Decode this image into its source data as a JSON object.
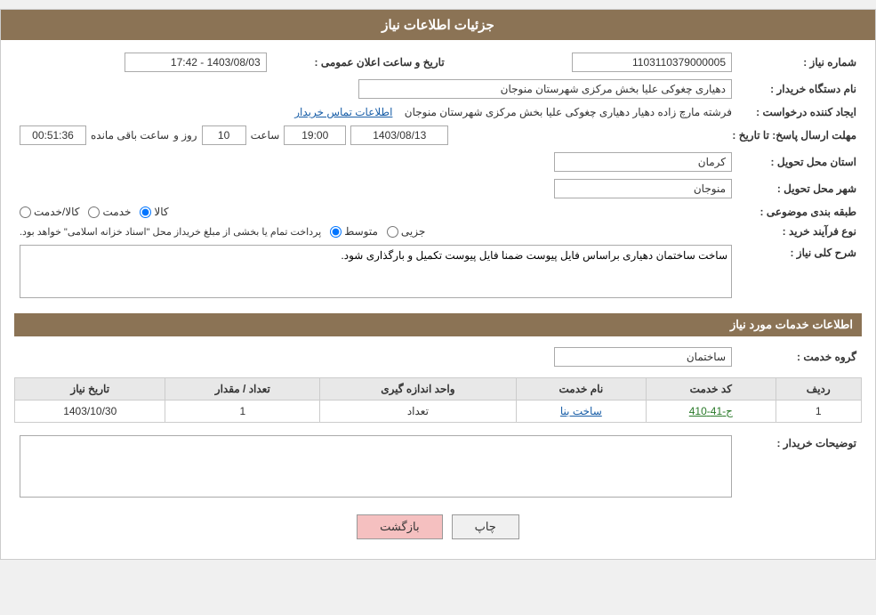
{
  "header": {
    "title": "جزئیات اطلاعات نیاز"
  },
  "fields": {
    "need_number_label": "شماره نیاز :",
    "need_number_value": "1103110379000005",
    "announce_date_label": "تاریخ و ساعت اعلان عمومی :",
    "announce_date_value": "1403/08/03 - 17:42",
    "buyer_org_label": "نام دستگاه خریدار :",
    "buyer_org_value": "دهیاری چغوکی علیا بخش مرکزی شهرستان منوجان",
    "creator_label": "ایجاد کننده درخواست :",
    "creator_value": "فرشته مارچ زاده دهیار دهیاری چغوکی علیا بخش مرکزی شهرستان منوجان",
    "contact_link": "اطلاعات تماس خریدار",
    "deadline_label": "مهلت ارسال پاسخ: تا تاریخ :",
    "deadline_date": "1403/08/13",
    "deadline_time": "19:00",
    "deadline_days": "10",
    "deadline_countdown": "00:51:36",
    "deadline_remaining": "ساعت باقی مانده",
    "deadline_days_label": "روز و",
    "province_label": "استان محل تحویل :",
    "province_value": "کرمان",
    "city_label": "شهر محل تحویل :",
    "city_value": "منوجان",
    "category_label": "طبقه بندی موضوعی :",
    "category_options": [
      "کالا",
      "خدمت",
      "کالا/خدمت"
    ],
    "category_selected": "کالا",
    "process_label": "نوع فرآیند خرید :",
    "process_options": [
      "جزیی",
      "متوسط"
    ],
    "process_selected": "متوسط",
    "process_note": "پرداخت تمام یا بخشی از مبلغ خریداز محل \"اسناد خزانه اسلامی\" خواهد بود.",
    "description_label": "شرح کلی نیاز :",
    "description_value": "ساخت ساختمان دهیاری براساس فایل پیوست ضمنا فایل پیوست تکمیل و بارگذاری شود.",
    "services_section_title": "اطلاعات خدمات مورد نیاز",
    "service_group_label": "گروه خدمت :",
    "service_group_value": "ساختمان",
    "table": {
      "headers": [
        "ردیف",
        "کد خدمت",
        "نام خدمت",
        "واحد اندازه گیری",
        "تعداد / مقدار",
        "تاریخ نیاز"
      ],
      "rows": [
        {
          "row": "1",
          "code": "ج-41-410",
          "name": "ساخت بنا",
          "unit": "تعداد",
          "quantity": "1",
          "date": "1403/10/30"
        }
      ]
    },
    "buyer_notes_label": "توضیحات خریدار :",
    "buyer_notes_value": ""
  },
  "buttons": {
    "print": "چاپ",
    "back": "بازگشت"
  }
}
